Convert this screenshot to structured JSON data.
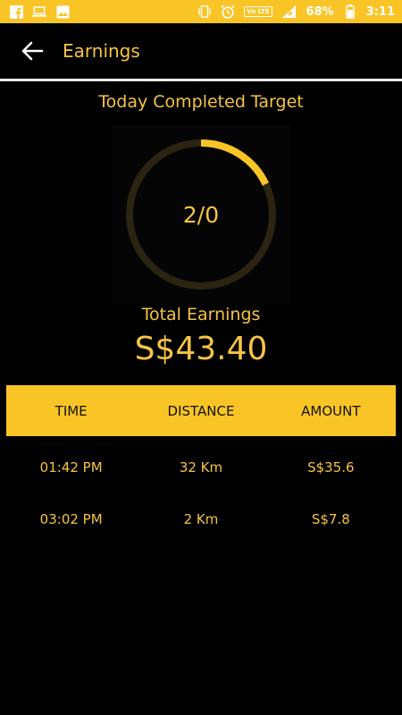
{
  "status_bar": {
    "battery": "68%",
    "time": "3:11",
    "network_badge": "Vo LTE",
    "lte_label": "LTE",
    "icons": [
      "facebook-icon",
      "laptop-icon",
      "image-icon",
      "vibrate-icon",
      "alarm-icon",
      "signal-icon",
      "battery-icon"
    ]
  },
  "app_bar": {
    "title": "Earnings"
  },
  "target": {
    "title": "Today Completed Target",
    "progress_label": "2/0",
    "progress_fraction": 0.18
  },
  "earnings": {
    "label": "Total Earnings",
    "value": "S$43.40"
  },
  "table": {
    "headers": [
      "TIME",
      "DISTANCE",
      "AMOUNT"
    ],
    "rows": [
      {
        "time": "01:42 PM",
        "distance": "32 Km",
        "amount": "S$35.6"
      },
      {
        "time": "03:02 PM",
        "distance": "2 Km",
        "amount": "S$7.8"
      }
    ]
  },
  "colors": {
    "accent": "#f9c526",
    "text_accent": "#f6c445",
    "background": "#000000",
    "ring_track": "#2a2410"
  }
}
